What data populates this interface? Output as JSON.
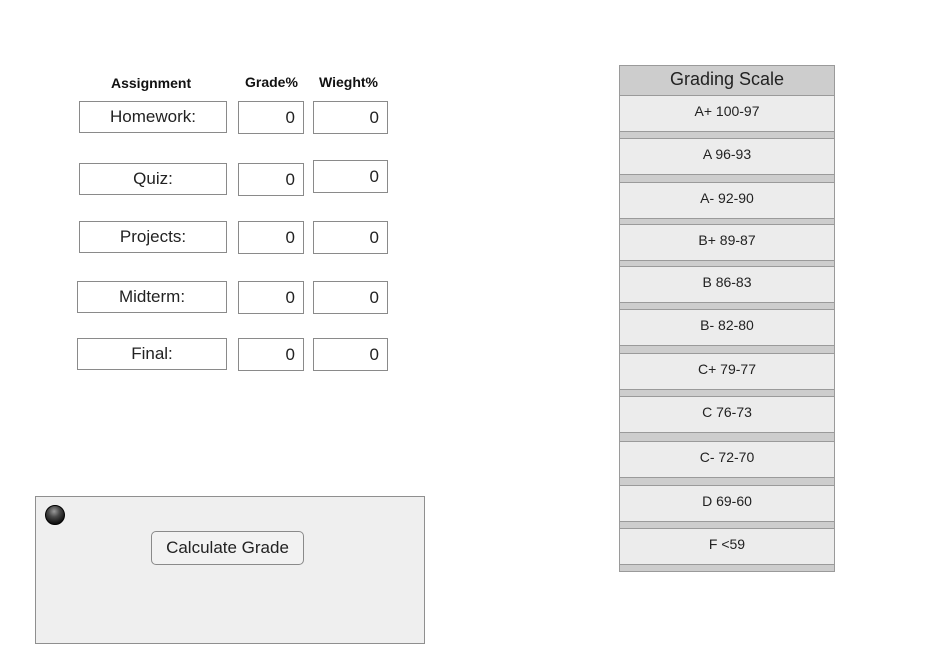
{
  "headers": {
    "assignment": "Assignment",
    "grade": "Grade%",
    "weight": "Wieght%"
  },
  "assignments": [
    {
      "label": "Homework:",
      "grade": "0",
      "weight": "0"
    },
    {
      "label": "Quiz:",
      "grade": "0",
      "weight": "0"
    },
    {
      "label": "Projects:",
      "grade": "0",
      "weight": "0"
    },
    {
      "label": "Midterm:",
      "grade": "0",
      "weight": "0"
    },
    {
      "label": "Final:",
      "grade": "0",
      "weight": "0"
    }
  ],
  "calculate": {
    "button_label": "Calculate Grade"
  },
  "grading_scale": {
    "title": "Grading Scale",
    "items": [
      "A+ 100-97",
      "A 96-93",
      "A- 92-90",
      "B+ 89-87",
      "B 86-83",
      "B- 82-80",
      "C+ 79-77",
      "C 76-73",
      "C- 72-70",
      "D 69-60",
      "F <59"
    ]
  }
}
